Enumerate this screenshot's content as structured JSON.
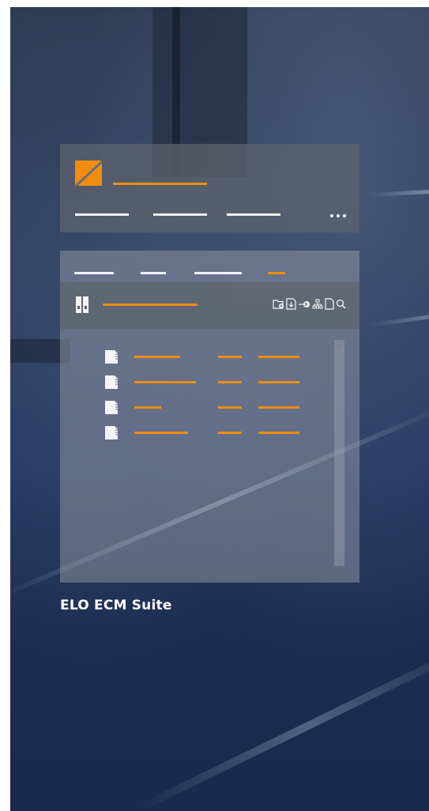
{
  "product": {
    "name": "ELO ECM Suite"
  },
  "colors": {
    "accent": "#ef8d0d",
    "panel_dark": "#5f646e",
    "panel_light": "#8c94a2",
    "background": "#22345a",
    "text_on_dark": "#ffffff"
  },
  "top_card": {
    "logo": "elo-logo-icon",
    "overflow_menu": "more-dots-icon"
  },
  "repository": {
    "toolbar_icon": "archive-binder-icon",
    "tools": [
      "new-folder-icon",
      "insert-document-icon",
      "move-to-icon",
      "hierarchy-icon",
      "new-document-icon",
      "search-icon"
    ],
    "item_icon": "document-icon",
    "rows": [
      {
        "id": "row-1"
      },
      {
        "id": "row-2"
      },
      {
        "id": "row-3"
      },
      {
        "id": "row-4"
      }
    ]
  }
}
